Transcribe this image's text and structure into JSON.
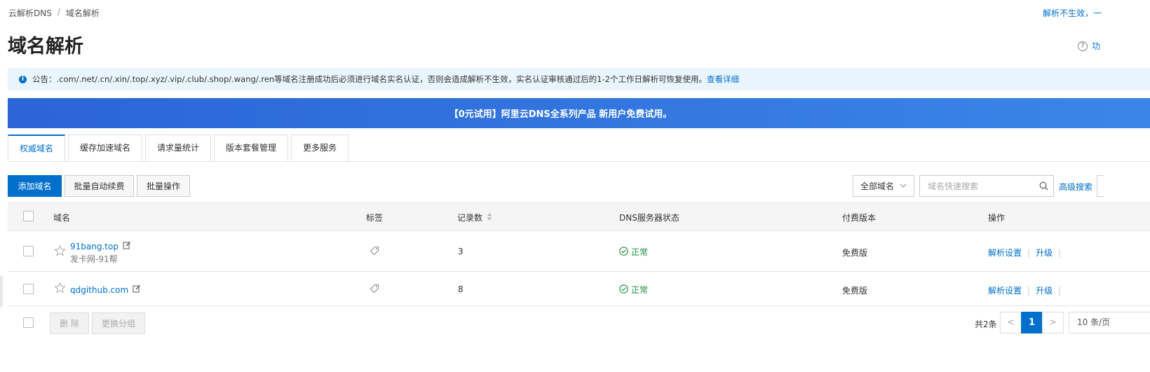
{
  "breadcrumb": {
    "root": "云解析DNS",
    "separator": "/",
    "current": "域名解析"
  },
  "top_right_link": "解析不生效，一",
  "page_title": "域名解析",
  "help_label": "功",
  "notice": {
    "text": "公告：.com/.net/.cn/.xin/.top/.xyz/.vip/.club/.shop/.wang/.ren等域名注册成功后必须进行域名实名认证，否则会造成解析不生效，实名认证审核通过后的1-2个工作日解析可恢复使用。",
    "link": "查看详细"
  },
  "banner": {
    "text": "【0元试用】阿里云DNS全系列产品 新用户免费试用。"
  },
  "tabs": [
    {
      "label": "权威域名",
      "active": true
    },
    {
      "label": "缓存加速域名",
      "active": false
    },
    {
      "label": "请求量统计",
      "active": false
    },
    {
      "label": "版本套餐管理",
      "active": false
    },
    {
      "label": "更多服务",
      "active": false
    }
  ],
  "toolbar": {
    "add_label": "添加域名",
    "renew_label": "批量自动续费",
    "batch_label": "批量操作",
    "filter_value": "全部域名",
    "search_placeholder": "域名快速搜索",
    "advanced_search": "高级搜索"
  },
  "table": {
    "headers": {
      "domain": "域名",
      "tag": "标签",
      "records": "记录数",
      "dns_status": "DNS服务器状态",
      "edition": "付费版本",
      "actions": "操作"
    },
    "rows": [
      {
        "domain": "91bang.top",
        "remark": "发卡网-91帮",
        "records": "3",
        "status": "正常",
        "edition": "免费版",
        "action_settings": "解析设置",
        "action_upgrade": "升级"
      },
      {
        "domain": "qdgithub.com",
        "remark": "",
        "records": "8",
        "status": "正常",
        "edition": "免费版",
        "action_settings": "解析设置",
        "action_upgrade": "升级"
      }
    ]
  },
  "footer": {
    "delete_label": "删 除",
    "change_group_label": "更换分组",
    "total": "共2条",
    "prev": "<",
    "current_page": "1",
    "next": ">",
    "page_size": "10 条/页"
  },
  "colors": {
    "accent": "#0070cc",
    "success": "#1e8e3e",
    "notice_bg": "#e9f5fc"
  }
}
